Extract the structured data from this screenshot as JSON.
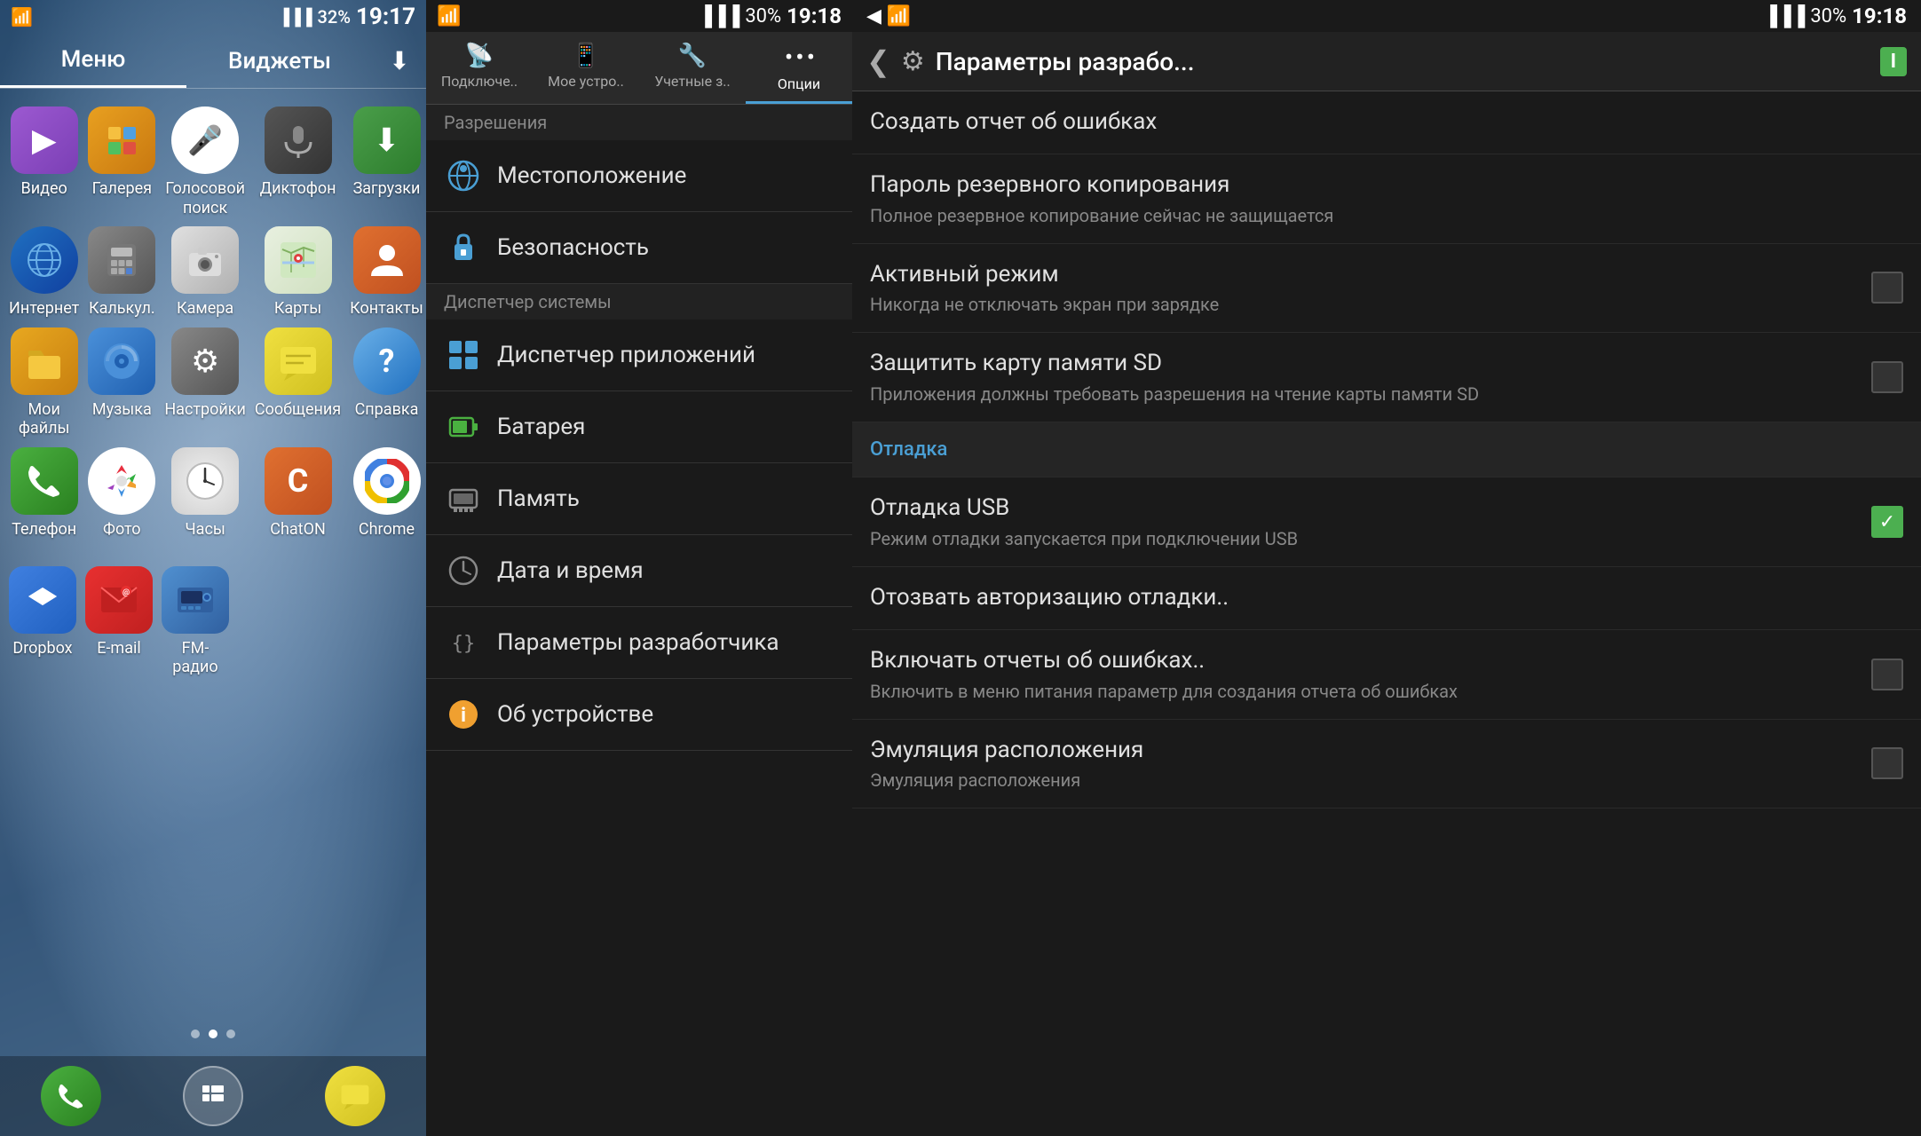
{
  "screen1": {
    "status": {
      "wifi": "📶",
      "signal": "▋▋▋",
      "battery": "32%",
      "time": "19:17"
    },
    "tabs": [
      "Меню",
      "Виджеты"
    ],
    "download_icon": "⬇",
    "apps": [
      {
        "id": "video",
        "label": "Видео",
        "icon": "▶",
        "bg": "icon-video"
      },
      {
        "id": "gallery",
        "label": "Галерея",
        "icon": "🖼",
        "bg": "icon-gallery"
      },
      {
        "id": "voice",
        "label": "Голосовой поиск",
        "icon": "🎤",
        "bg": "icon-voice",
        "color": "#e33"
      },
      {
        "id": "dictaphone",
        "label": "Диктофон",
        "icon": "🎙",
        "bg": "icon-dictaphone"
      },
      {
        "id": "downloads",
        "label": "Загрузки",
        "icon": "⬇",
        "bg": "icon-downloads"
      },
      {
        "id": "internet",
        "label": "Интернет",
        "icon": "🌐",
        "bg": "icon-internet"
      },
      {
        "id": "calc",
        "label": "Калькул.",
        "icon": "🔢",
        "bg": "icon-calc"
      },
      {
        "id": "camera",
        "label": "Камера",
        "icon": "📷",
        "bg": "icon-camera"
      },
      {
        "id": "maps",
        "label": "Карты",
        "icon": "📍",
        "bg": "icon-maps"
      },
      {
        "id": "contacts",
        "label": "Контакты",
        "icon": "👤",
        "bg": "icon-contacts"
      },
      {
        "id": "files",
        "label": "Мои файлы",
        "icon": "📁",
        "bg": "icon-files"
      },
      {
        "id": "music",
        "label": "Музыка",
        "icon": "▶",
        "bg": "icon-music"
      },
      {
        "id": "settings",
        "label": "Настройки",
        "icon": "⚙",
        "bg": "icon-settings"
      },
      {
        "id": "messages",
        "label": "Сообщения",
        "icon": "✉",
        "bg": "icon-messages"
      },
      {
        "id": "help",
        "label": "Справка",
        "icon": "?",
        "bg": "icon-help"
      },
      {
        "id": "phone",
        "label": "Телефон",
        "icon": "📞",
        "bg": "icon-phone"
      },
      {
        "id": "photos",
        "label": "Фото",
        "icon": "🌸",
        "bg": "icon-photos"
      },
      {
        "id": "clock",
        "label": "Часы",
        "icon": "🕐",
        "bg": "icon-clock"
      },
      {
        "id": "chaton",
        "label": "ChatON",
        "icon": "C",
        "bg": "icon-chaton"
      },
      {
        "id": "chrome",
        "label": "Chrome",
        "icon": "◎",
        "bg": "icon-chrome"
      },
      {
        "id": "dropbox",
        "label": "Dropbox",
        "icon": "📦",
        "bg": "icon-dropbox"
      },
      {
        "id": "email",
        "label": "E-mail",
        "icon": "@",
        "bg": "icon-email"
      },
      {
        "id": "fmradio",
        "label": "FM-радио",
        "icon": "📻",
        "bg": "icon-fmradio"
      }
    ],
    "dots": [
      false,
      true,
      false
    ]
  },
  "screen2": {
    "status": {
      "battery": "30%",
      "time": "19:18"
    },
    "tabs": [
      {
        "id": "connections",
        "label": "Подключе..",
        "icon": "📡"
      },
      {
        "id": "mydevice",
        "label": "Мое устро..",
        "icon": "📱"
      },
      {
        "id": "accounts",
        "label": "Учетные з..",
        "icon": "🔧"
      },
      {
        "id": "options",
        "label": "Опции",
        "icon": "⋯",
        "active": true
      }
    ],
    "section_header": "Разрешения",
    "items": [
      {
        "id": "location",
        "label": "Местоположение",
        "icon": "🌐",
        "iconColor": "#4a9fd4"
      },
      {
        "id": "security",
        "label": "Безопасность",
        "icon": "🔒",
        "iconColor": "#4a9fd4"
      },
      {
        "id": "sysmanager",
        "label": "Диспетчер системы",
        "icon": null,
        "section": true
      },
      {
        "id": "appmanager",
        "label": "Диспетчер приложений",
        "icon": "▦",
        "iconColor": "#4a9fd4"
      },
      {
        "id": "battery",
        "label": "Батарея",
        "icon": "🔋",
        "iconColor": "#4ab040"
      },
      {
        "id": "memory",
        "label": "Память",
        "icon": "💾",
        "iconColor": "#888"
      },
      {
        "id": "datetime",
        "label": "Дата и время",
        "icon": "🕐",
        "iconColor": "#888"
      },
      {
        "id": "devparams",
        "label": "Параметры разработчика",
        "icon": "{}",
        "iconColor": "#888"
      },
      {
        "id": "about",
        "label": "Об устройстве",
        "icon": "ℹ",
        "iconColor": "#f0a030"
      }
    ]
  },
  "screen3": {
    "status": {
      "battery": "30%",
      "time": "19:18"
    },
    "header": {
      "back": "❮",
      "icon": "⚙",
      "title": "Параметры разрабо...",
      "battery_label": "I"
    },
    "items": [
      {
        "id": "create_report",
        "title": "Создать отчет об ошибках",
        "subtitle": null,
        "checkbox": null
      },
      {
        "id": "backup_password",
        "title": "Пароль резервного копирования",
        "subtitle": "Полное резервное копирование сейчас не защищается",
        "checkbox": null
      },
      {
        "id": "active_mode",
        "title": "Активный режим",
        "subtitle": "Никогда не отключать экран при зарядке",
        "checkbox": "unchecked"
      },
      {
        "id": "protect_sd",
        "title": "Защитить карту памяти SD",
        "subtitle": "Приложения должны требовать разрешения на чтение карты памяти SD",
        "checkbox": "unchecked"
      },
      {
        "id": "debug_section",
        "section": true,
        "label": "Отладка"
      },
      {
        "id": "usb_debug",
        "title": "Отладка USB",
        "subtitle": "Режим отладки запускается при подключении USB",
        "checkbox": "checked"
      },
      {
        "id": "revoke_debug",
        "title": "Отозвать авторизацию отладки..",
        "subtitle": null,
        "checkbox": null
      },
      {
        "id": "error_reports",
        "title": "Включать отчеты об ошибках..",
        "subtitle": "Включить в меню питания параметр для создания отчета об ошибках",
        "checkbox": "unchecked"
      },
      {
        "id": "emulation",
        "title": "Эмуляция расположения",
        "subtitle": "Эмуляция расположения",
        "checkbox": "unchecked"
      }
    ]
  }
}
